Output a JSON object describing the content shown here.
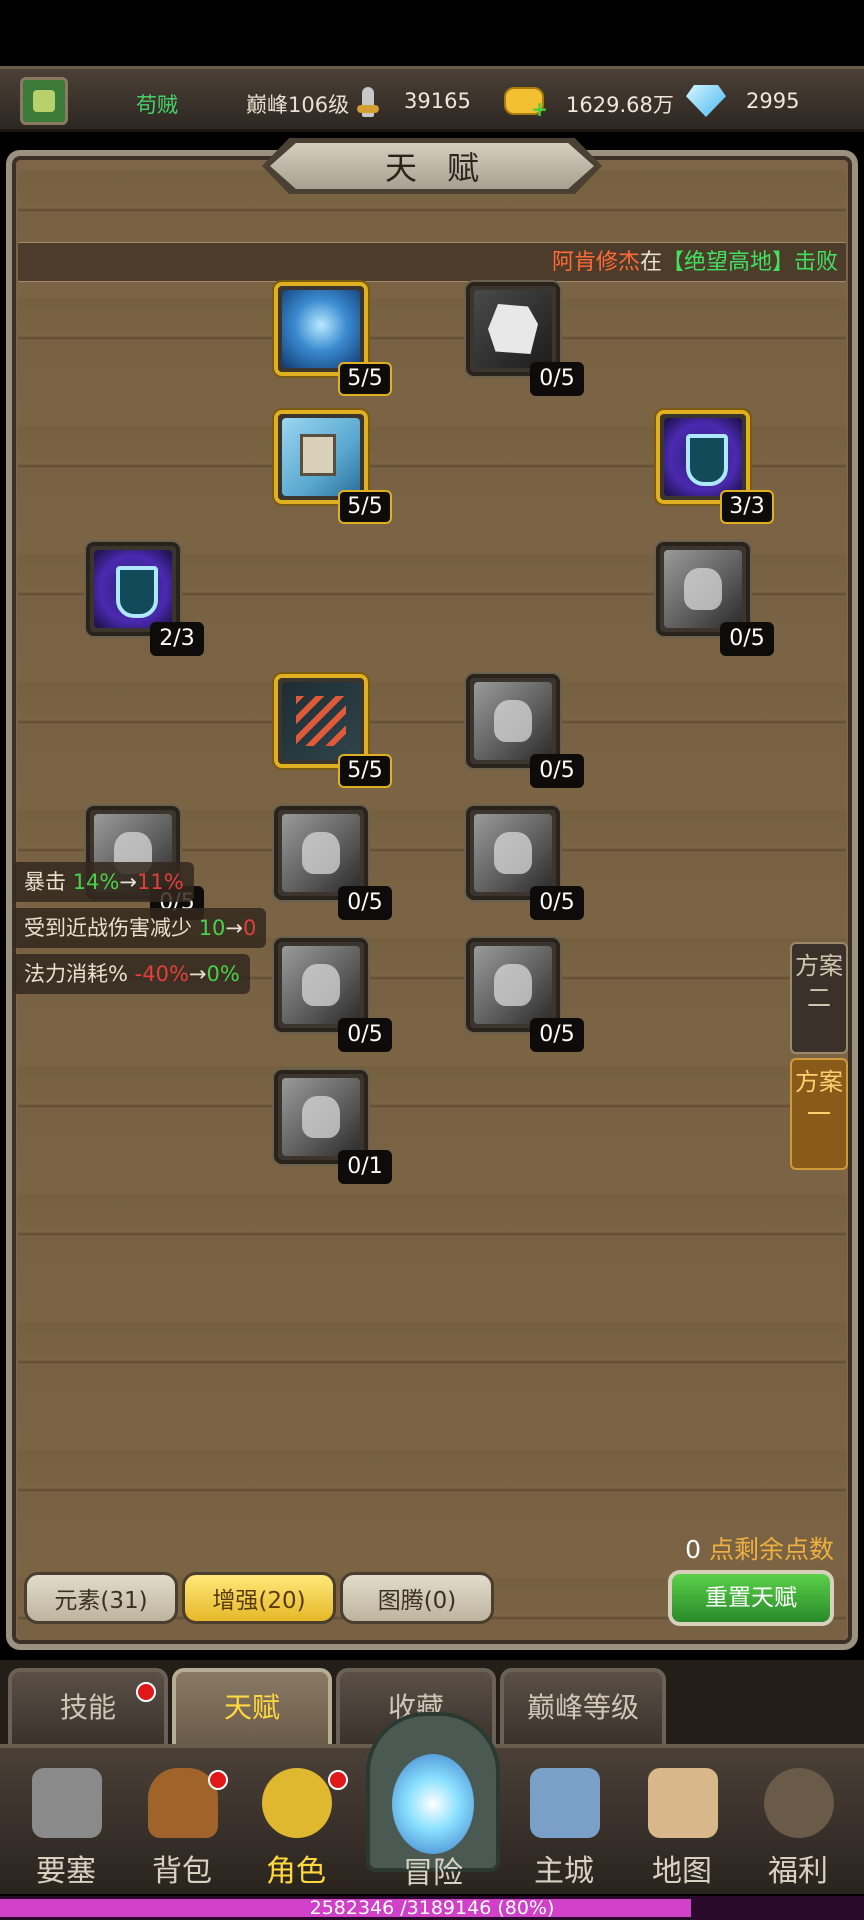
{
  "status": {
    "name": "苟贼",
    "level": "巅峰106级",
    "power": "39165",
    "gold": "1629.68万",
    "gems": "2995"
  },
  "title": "天赋",
  "ticker": {
    "player": "阿肯修杰",
    "mid": "在",
    "place": "【绝望高地】",
    "tail": "击败"
  },
  "talents": [
    {
      "count": "5/5"
    },
    {
      "count": "0/5"
    },
    {
      "count": "5/5"
    },
    {
      "count": "3/3"
    },
    {
      "count": "2/3"
    },
    {
      "count": "0/5"
    },
    {
      "count": "5/5"
    },
    {
      "count": "0/5"
    },
    {
      "count": "0/5"
    },
    {
      "count": "0/5"
    },
    {
      "count": "0/5"
    },
    {
      "count": "0/5"
    },
    {
      "count": "0/5"
    },
    {
      "count": "0/1"
    }
  ],
  "stats": [
    {
      "label": "暴击",
      "from": "14%",
      "arrow": "→",
      "to": "11%"
    },
    {
      "label": "受到近战伤害减少",
      "from": "10",
      "arrow": "→",
      "to": "0"
    },
    {
      "label": "法力消耗%",
      "from": "-40%",
      "arrow": "→",
      "to": "0%"
    }
  ],
  "schemes": {
    "scheme2": "方案二",
    "scheme1": "方案一"
  },
  "remaining": {
    "value": "0",
    "label": "点剩余点数"
  },
  "categories": {
    "element": "元素(31)",
    "enhance": "增强(20)",
    "totem": "图腾(0)"
  },
  "reset_label": "重置天赋",
  "subtabs": {
    "skills": "技能",
    "talent": "天赋",
    "collection": "收藏",
    "peak": "巅峰等级"
  },
  "nav": {
    "fortress": "要塞",
    "bag": "背包",
    "role": "角色",
    "adventure": "冒险",
    "city": "主城",
    "map": "地图",
    "welfare": "福利"
  },
  "xp": {
    "text": "2582346 /3189146 (80%)",
    "fraction": 0.8
  }
}
